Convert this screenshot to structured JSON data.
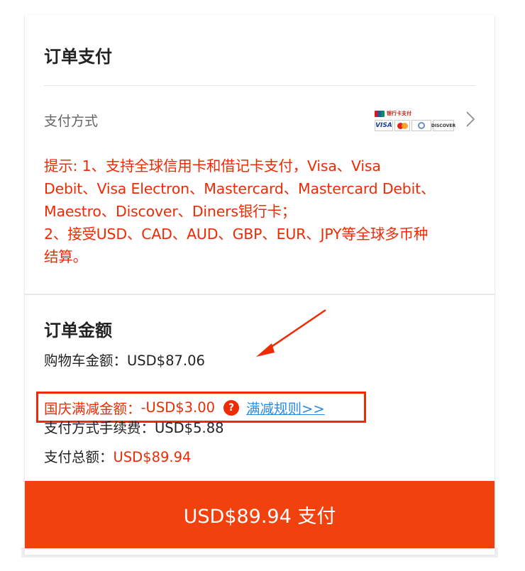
{
  "header": {
    "title": "订单支付"
  },
  "payment_method": {
    "label": "支付方式",
    "logos": [
      "unionpay-icon",
      "visa-icon",
      "mastercard-icon",
      "diners-club-icon",
      "discover-icon"
    ],
    "unionpay_text": "银行卡支付",
    "visa_text": "VISA",
    "discover_text": "DISCOVER"
  },
  "notice": {
    "text": "提示: 1、支持全球信用卡和借记卡支付，Visa、Visa\nDebit、Visa Electron、Mastercard、Mastercard Debit、\nMaestro、Discover、Diners银行卡；\n2、接受USD、CAD、AUD、GBP、EUR、JPY等全球多币种\n结算。"
  },
  "amount": {
    "title": "订单金额",
    "cart_label": "购物车金额：",
    "cart_value": "USD$87.06",
    "promo_label": "国庆满减金额：",
    "promo_value": "-USD$3.00",
    "promo_help": "?",
    "promo_rule_link": "满减规则>>",
    "fee_label": "支付方式手续费：",
    "fee_value": "USD$5.88",
    "total_label": "支付总额：",
    "total_value": "USD$89.94"
  },
  "pay_button": {
    "label": "USD$89.94 支付"
  },
  "colors": {
    "accent": "#f0410f",
    "warning_text": "#ef2b04",
    "link": "#2a8be0"
  }
}
